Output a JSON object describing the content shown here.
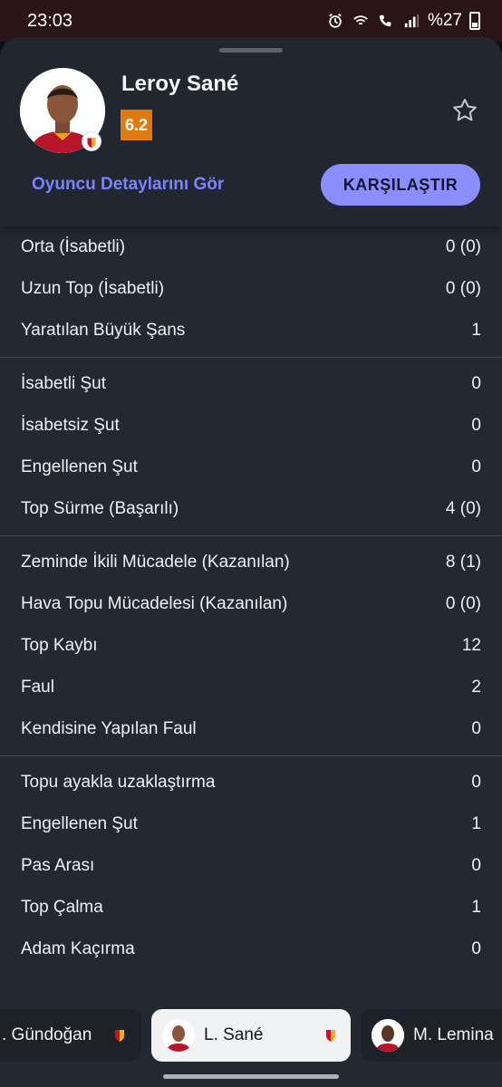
{
  "status_bar": {
    "time": "23:03",
    "battery": "%27"
  },
  "player": {
    "name": "Leroy Sané",
    "rating": "6.2",
    "details_link": "Oyuncu Detaylarını Gör",
    "compare_button": "KARŞILAŞTIR"
  },
  "colors": {
    "accent": "#8a8eff",
    "rating": "#e17a0c",
    "link": "#7b84ff",
    "sheet": "#242831"
  },
  "stat_groups": [
    {
      "rows": [
        {
          "label": "Orta (İsabetli)",
          "value": "0 (0)"
        },
        {
          "label": "Uzun Top (İsabetli)",
          "value": "0 (0)"
        },
        {
          "label": "Yaratılan Büyük Şans",
          "value": "1"
        }
      ]
    },
    {
      "rows": [
        {
          "label": "İsabetli Şut",
          "value": "0"
        },
        {
          "label": "İsabetsiz Şut",
          "value": "0"
        },
        {
          "label": "Engellenen Şut",
          "value": "0"
        },
        {
          "label": "Top Sürme (Başarılı)",
          "value": "4 (0)"
        }
      ]
    },
    {
      "rows": [
        {
          "label": "Zeminde İkili Mücadele (Kazanılan)",
          "value": "8 (1)"
        },
        {
          "label": "Hava Topu Mücadelesi (Kazanılan)",
          "value": "0 (0)"
        },
        {
          "label": "Top Kaybı",
          "value": "12"
        },
        {
          "label": "Faul",
          "value": "2"
        },
        {
          "label": "Kendisine Yapılan Faul",
          "value": "0"
        }
      ]
    },
    {
      "rows": [
        {
          "label": "Topu ayakla uzaklaştırma",
          "value": "0"
        },
        {
          "label": "Engellenen Şut",
          "value": "1"
        },
        {
          "label": "Pas Arası",
          "value": "0"
        },
        {
          "label": "Top Çalma",
          "value": "1"
        },
        {
          "label": "Adam Kaçırma",
          "value": "0"
        }
      ]
    }
  ],
  "carousel": {
    "left": ". Gündoğan",
    "active": "L. Sané",
    "right": "M. Lemina"
  }
}
